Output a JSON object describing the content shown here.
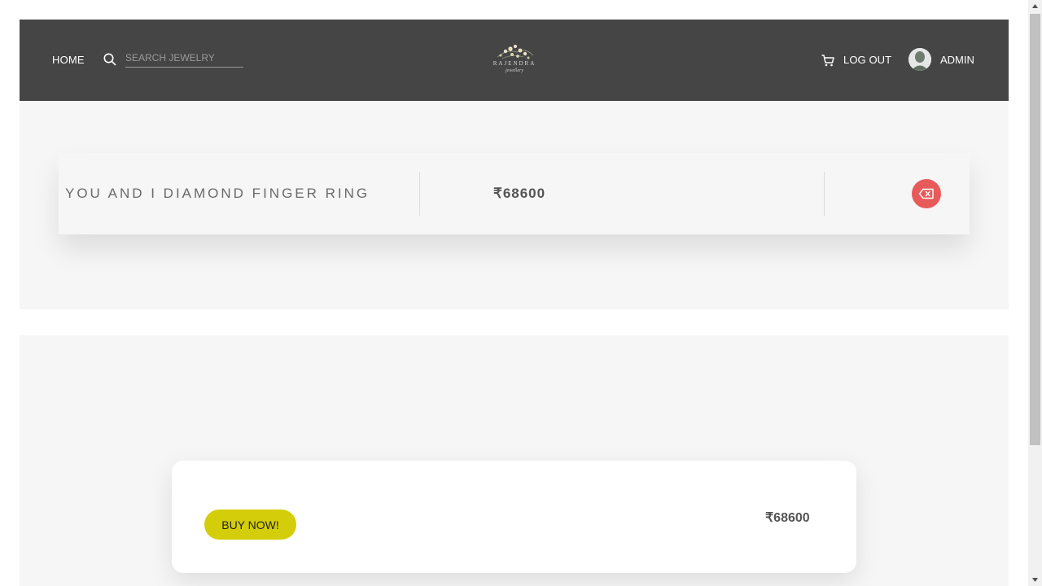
{
  "header": {
    "home_label": "HOME",
    "search_placeholder": "SEARCH JEWELRY",
    "search_value": "",
    "logo_name": "RAJENDRA",
    "logo_tagline": "jewellery",
    "logout_label": "LOG OUT",
    "admin_label": "ADMIN"
  },
  "cart": {
    "items": [
      {
        "name": "YOU AND I DIAMOND FINGER RING",
        "price": "₹68600"
      }
    ]
  },
  "checkout": {
    "buy_label": "BUY NOW!",
    "total": "₹68600"
  },
  "icons": {
    "search": "search-icon",
    "cart": "cart-icon",
    "remove": "backspace-icon",
    "avatar": "avatar"
  },
  "colors": {
    "header_bg": "#454545",
    "section_bg": "#f6f6f6",
    "remove_red": "#e85a5a",
    "buy_yellow": "#d4cd0a"
  }
}
